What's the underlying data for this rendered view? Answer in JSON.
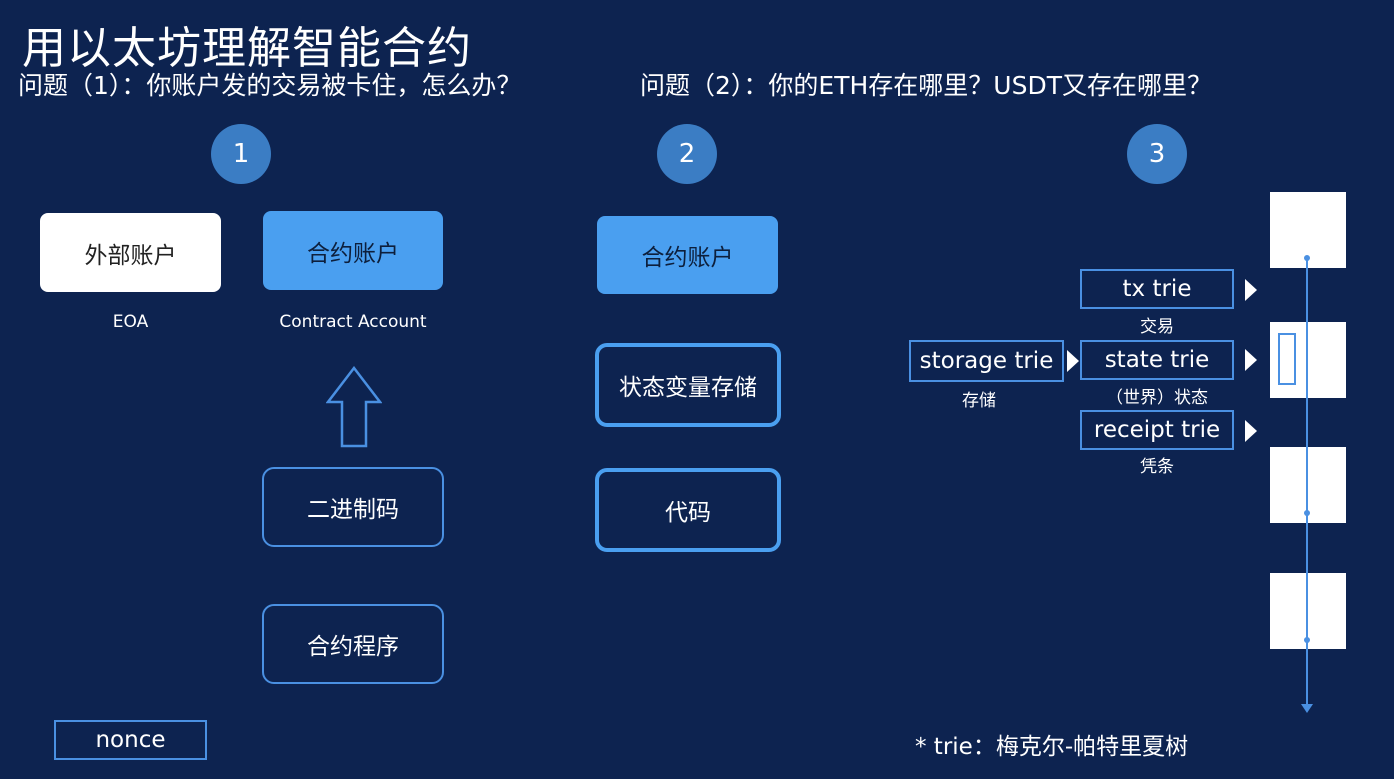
{
  "title": "用以太坊理解智能合约",
  "questions": {
    "q1": "问题（1）：你账户发的交易被卡住，怎么办？",
    "q2": "问题（2）：你的ETH存在哪里？USDT又存在哪里？"
  },
  "steps": [
    "1",
    "2",
    "3"
  ],
  "section1": {
    "eoa_box": "外部账户",
    "eoa_label": "EOA",
    "contract_box": "合约账户",
    "contract_label": "Contract Account",
    "bytecode": "二进制码",
    "program": "合约程序",
    "nonce": "nonce"
  },
  "section2": {
    "contract_box": "合约账户",
    "state_storage": "状态变量存储",
    "code": "代码"
  },
  "section3": {
    "storage_trie": "storage trie",
    "storage_label": "存储",
    "tx_trie": "tx trie",
    "tx_label": "交易",
    "state_trie": "state trie",
    "state_label": "（世界）状态",
    "receipt_trie": "receipt trie",
    "receipt_label": "凭条"
  },
  "footnote": "* trie：梅克尔-帕特里夏树",
  "colors": {
    "background": "#0d2350",
    "circle": "#3b7dc4",
    "accent_box": "#4a9ff0",
    "outline": "#4a90e2"
  }
}
